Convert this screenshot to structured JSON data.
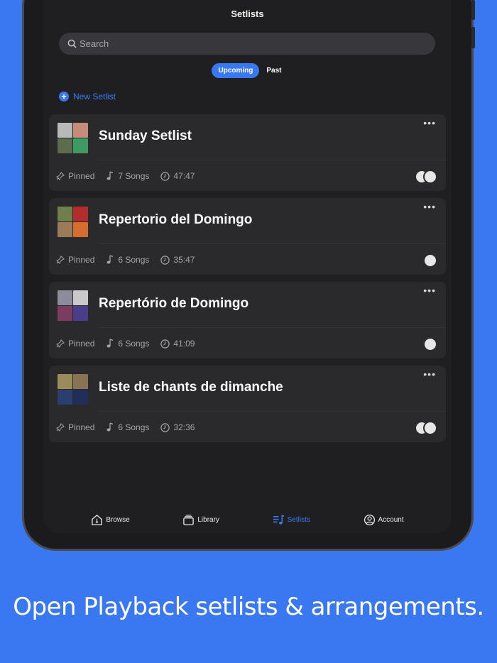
{
  "header": {
    "title": "Setlists"
  },
  "search": {
    "placeholder": "Search"
  },
  "segments": {
    "active": "Upcoming",
    "inactive": "Past"
  },
  "actions": {
    "new_setlist": "New Setlist"
  },
  "cards": [
    {
      "name": "Sunday Setlist",
      "pinned": "Pinned",
      "songs": "7 Songs",
      "duration": "47:47",
      "avatars": 2,
      "art": [
        "#b9b9b9",
        "#c58c7a",
        "#5b6d4d",
        "#3e9a63"
      ]
    },
    {
      "name": "Repertorio del Domingo",
      "pinned": "Pinned",
      "songs": "6 Songs",
      "duration": "35:47",
      "avatars": 1,
      "art": [
        "#6e7f4c",
        "#b32d2d",
        "#9b7b5a",
        "#d46d2e"
      ]
    },
    {
      "name": "Repertório de Domingo",
      "pinned": "Pinned",
      "songs": "6 Songs",
      "duration": "41:09",
      "avatars": 1,
      "art": [
        "#8c8c9a",
        "#c9c9c9",
        "#7a3d5f",
        "#4a3d8a"
      ]
    },
    {
      "name": "Liste de chants de dimanche",
      "pinned": "Pinned",
      "songs": "6 Songs",
      "duration": "32:36",
      "avatars": 2,
      "art": [
        "#9b8a5a",
        "#8a7355",
        "#2b3f6e",
        "#1f2f5a"
      ]
    }
  ],
  "tabbar": {
    "browse": "Browse",
    "library": "Library",
    "setlists": "Setlists",
    "account": "Account"
  },
  "caption": "Open Playback setlists & arrangements.",
  "colors": {
    "accent": "#3a78f2",
    "background": "#3a78f2",
    "card": "#2a2a2d"
  }
}
